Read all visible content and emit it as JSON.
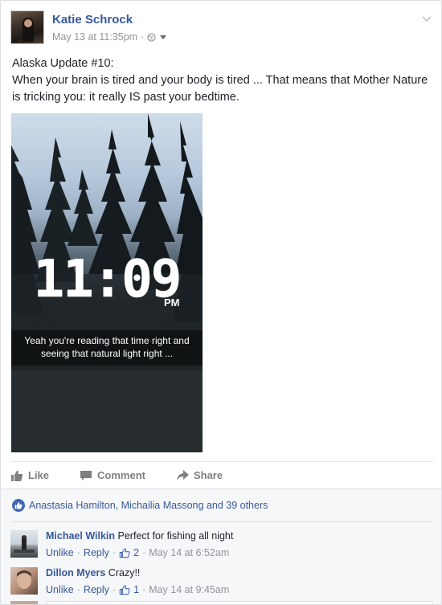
{
  "post": {
    "author": "Katie Schrock",
    "timestamp": "May 13 at 11:35pm",
    "separator": "·",
    "privacy_icon": "globe-icon",
    "text_line1": "Alaska Update #10:",
    "text_line2": "When your brain is tired and your body is tired ... That means that Mother Nature is tricking you: it really IS past your bedtime."
  },
  "photo": {
    "time": "11:09",
    "ampm": "PM",
    "caption_line1": "Yeah you're reading that time right and",
    "caption_line2": "seeing that natural light right ..."
  },
  "actions": {
    "like": "Like",
    "comment": "Comment",
    "share": "Share"
  },
  "reactions": {
    "summary": "Anastasia Hamilton, Michailia Massong and 39 others"
  },
  "comments": [
    {
      "name": "Michael Wilkin",
      "text": "Perfect for fishing all night",
      "unlike": "Unlike",
      "reply": "Reply",
      "likes": "2",
      "time": "May 14 at 6:52am"
    },
    {
      "name": "Dillon Myers",
      "text": "Crazy!!",
      "unlike": "Unlike",
      "reply": "Reply",
      "likes": "1",
      "time": "May 14 at 9:45am"
    }
  ],
  "colors": {
    "link": "#365899",
    "meta": "#90949c",
    "like_blue": "#4267b2"
  }
}
